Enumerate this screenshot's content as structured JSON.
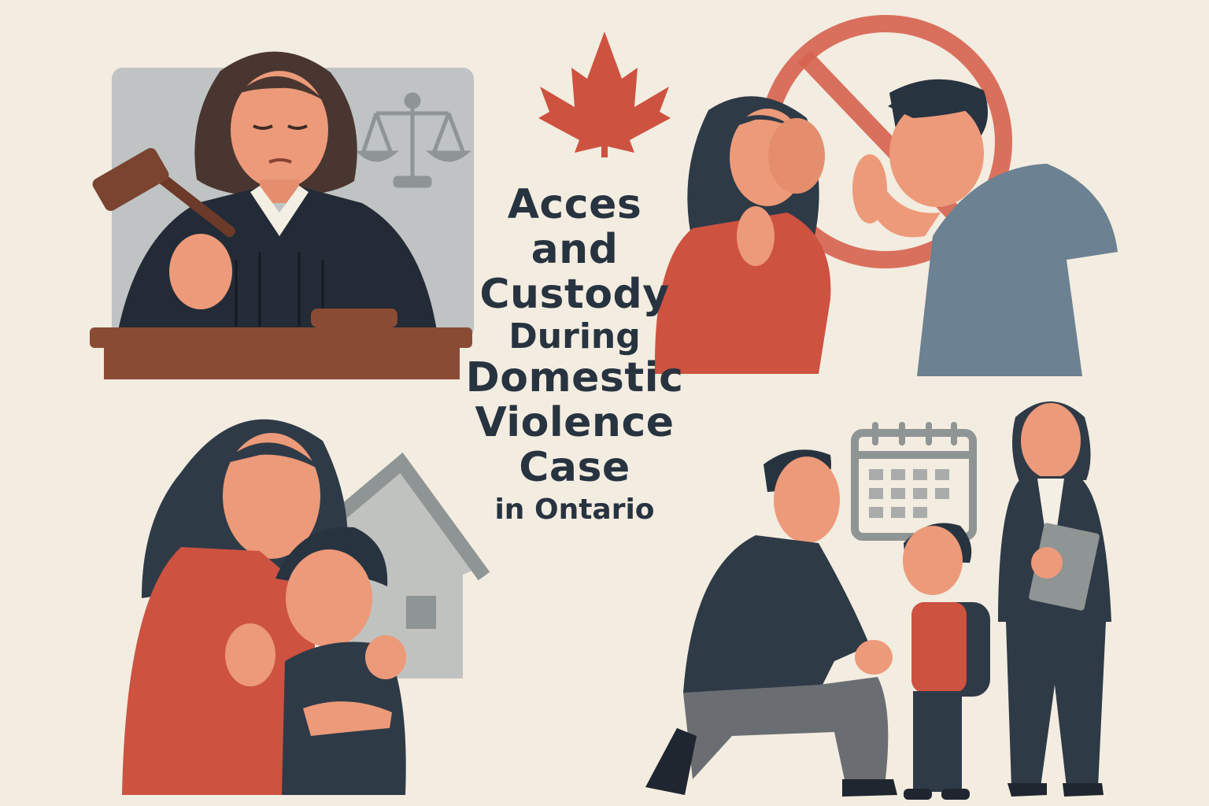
{
  "title": {
    "line1": "Acces",
    "line2": "and",
    "line3": "Custody",
    "line4": "During",
    "line5": "Domestic",
    "line6": "Violence",
    "line7": "Case",
    "line8": "in Ontario"
  },
  "colors": {
    "background": "#f3ece0",
    "accent_red": "#cd5240",
    "navy_text": "#283340",
    "court_wood": "#8a4b34",
    "robe": "#232b36",
    "gray_panel": "#bfc3c3",
    "shirt_blue": "#6c8191"
  },
  "icons": [
    "maple-leaf-icon",
    "scales-of-justice-icon",
    "gavel-icon",
    "prohibition-sign-icon",
    "house-icon",
    "calendar-icon",
    "backpack-icon"
  ]
}
